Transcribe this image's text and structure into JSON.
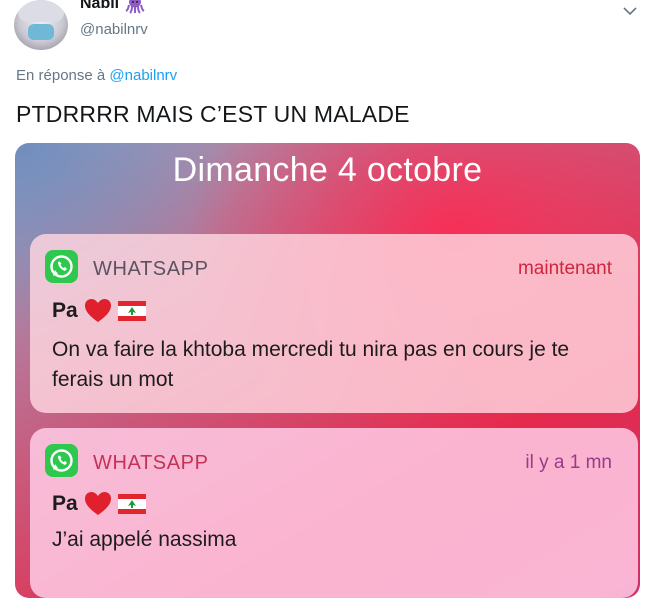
{
  "tweet": {
    "display_name": "Nabil",
    "name_emoji_icon": "octopus-emoji-icon",
    "handle": "@nabilnrv",
    "reply_prefix": "En réponse à",
    "reply_to": "@nabilnrv",
    "text": "PTDRRRR MAIS C’EST UN MALADE"
  },
  "screenshot": {
    "date": "Dimanche 4 octobre",
    "notifications": [
      {
        "app": "WHATSAPP",
        "time": "maintenant",
        "sender": "Pa",
        "sender_icons": [
          "red-heart-emoji-icon",
          "lebanon-flag-icon"
        ],
        "message": "On va faire la khtoba mercredi tu nira pas en cours je te ferais un mot"
      },
      {
        "app": "WHATSAPP",
        "time": "il y a 1 mn",
        "sender": "Pa",
        "sender_icons": [
          "red-heart-emoji-icon",
          "lebanon-flag-icon"
        ],
        "message": "J’ai appelé nassima"
      }
    ]
  },
  "colors": {
    "link": "#1da1f2",
    "muted": "#657786",
    "whatsapp_green": "#2fc84e",
    "timestamp_red": "#d1253f"
  }
}
